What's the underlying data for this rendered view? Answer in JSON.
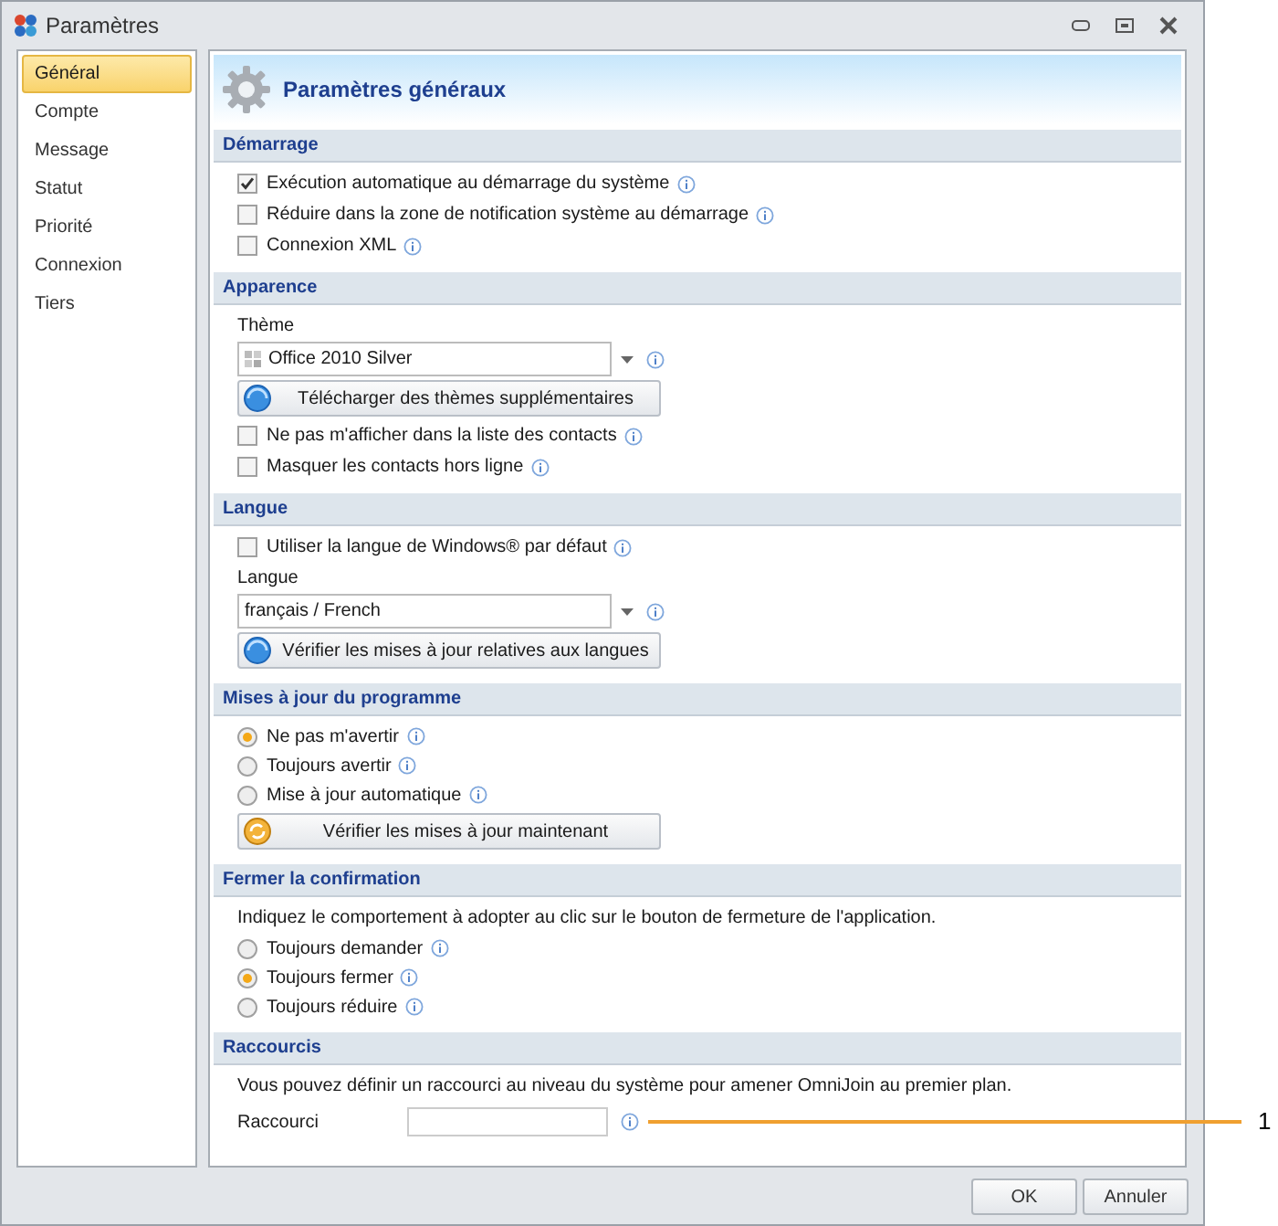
{
  "window": {
    "title": "Paramètres"
  },
  "sidebar": {
    "items": [
      {
        "label": "Général",
        "selected": true
      },
      {
        "label": "Compte",
        "selected": false
      },
      {
        "label": "Message",
        "selected": false
      },
      {
        "label": "Statut",
        "selected": false
      },
      {
        "label": "Priorité",
        "selected": false
      },
      {
        "label": "Connexion",
        "selected": false
      },
      {
        "label": "Tiers",
        "selected": false
      }
    ]
  },
  "header": {
    "title": "Paramètres généraux"
  },
  "sections": [
    {
      "title": "Démarrage",
      "items": [
        {
          "kind": "checkbox",
          "label": "Exécution automatique au démarrage du système",
          "checked": true
        },
        {
          "kind": "checkbox",
          "label": "Réduire dans la zone de notification système au démarrage",
          "checked": false
        },
        {
          "kind": "checkbox",
          "label": "Connexion XML",
          "checked": false
        }
      ]
    },
    {
      "title": "Apparence",
      "items": [
        {
          "kind": "select",
          "label": "Thème",
          "value": "Office 2010 Silver"
        },
        {
          "kind": "button",
          "label": "Télécharger des thèmes supplémentaires"
        },
        {
          "kind": "checkbox",
          "label": "Ne pas m'afficher dans la liste des contacts",
          "checked": false
        },
        {
          "kind": "checkbox",
          "label": "Masquer les contacts hors ligne",
          "checked": false
        }
      ]
    },
    {
      "title": "Langue",
      "items": [
        {
          "kind": "checkbox",
          "label": "Utiliser la langue de Windows® par défaut",
          "checked": false
        },
        {
          "kind": "select",
          "label": "Langue",
          "value": "français / French"
        },
        {
          "kind": "button",
          "label": "Vérifier les mises à jour relatives aux langues"
        }
      ]
    },
    {
      "title": "Mises à jour du programme",
      "items": [
        {
          "kind": "radio",
          "label": "Ne pas m'avertir",
          "selected": true
        },
        {
          "kind": "radio",
          "label": "Toujours avertir",
          "selected": false
        },
        {
          "kind": "radio",
          "label": "Mise à jour automatique",
          "selected": false
        },
        {
          "kind": "button",
          "label": "Vérifier les mises à jour maintenant"
        }
      ]
    },
    {
      "title": "Fermer la confirmation",
      "items": [
        {
          "kind": "text",
          "text": "Indiquez le comportement à adopter au clic sur le bouton de fermeture de l'application."
        },
        {
          "kind": "radio",
          "label": "Toujours demander",
          "selected": false
        },
        {
          "kind": "radio",
          "label": "Toujours fermer",
          "selected": true
        },
        {
          "kind": "radio",
          "label": "Toujours réduire",
          "selected": false
        }
      ]
    },
    {
      "title": "Raccourcis",
      "items": [
        {
          "kind": "text",
          "text": "Vous pouvez définir un raccourci au niveau du système pour amener OmniJoin au premier plan."
        },
        {
          "kind": "field",
          "label": "Raccourci"
        }
      ]
    }
  ],
  "buttons": [
    "OK",
    "Annuler"
  ],
  "callout": {
    "label": "1"
  }
}
